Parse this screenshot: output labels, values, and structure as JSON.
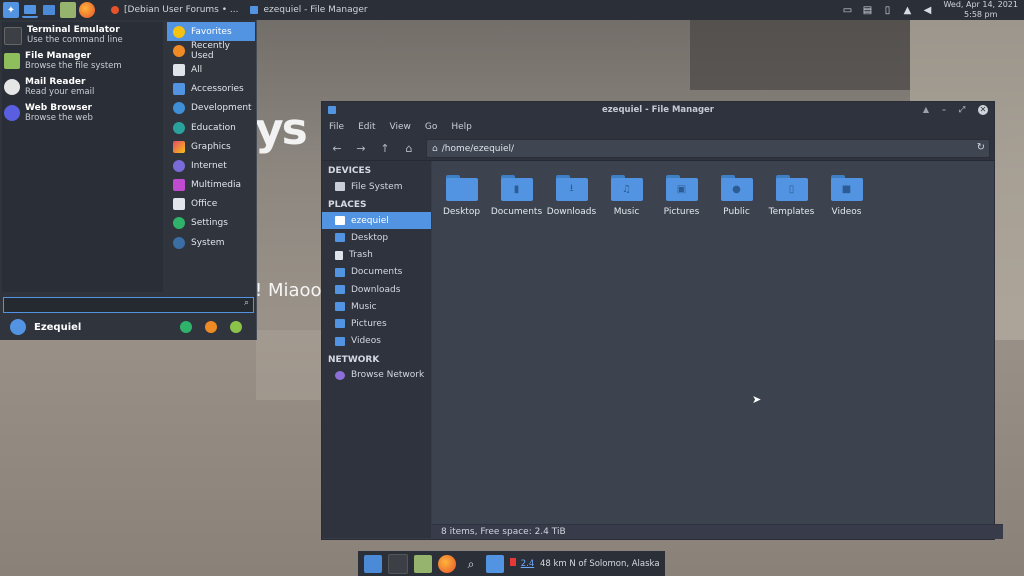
{
  "top_panel": {
    "tasks": [
      {
        "label": "[Debian User Forums • ..."
      },
      {
        "label": "ezequiel - File Manager"
      }
    ],
    "clock": {
      "date": "Wed, Apr 14, 2021",
      "time": "5:58 pm"
    }
  },
  "desktop": {
    "text_large": "ys",
    "text_small": "! Miaoo"
  },
  "whisker_menu": {
    "favorites": [
      {
        "title": "Terminal Emulator",
        "subtitle": "Use the command line",
        "icon": "terminal-icon",
        "color": "#3c3f45"
      },
      {
        "title": "File Manager",
        "subtitle": "Browse the file system",
        "icon": "file-manager-icon",
        "color": "#8fbf5c"
      },
      {
        "title": "Mail Reader",
        "subtitle": "Read your email",
        "icon": "mail-icon",
        "color": "#e6e6e6"
      },
      {
        "title": "Web Browser",
        "subtitle": "Browse the web",
        "icon": "browser-icon",
        "color": "#5a5ee0"
      }
    ],
    "categories": [
      {
        "label": "Favorites",
        "color": "#f5c211",
        "active": true
      },
      {
        "label": "Recently Used",
        "color": "#f08a24"
      },
      {
        "label": "All",
        "color": "#dfe3ea"
      },
      {
        "label": "Accessories",
        "color": "#5294e2"
      },
      {
        "label": "Development",
        "color": "#3f8fd8"
      },
      {
        "label": "Education",
        "color": "#2aa19c"
      },
      {
        "label": "Graphics",
        "color": "#e54a6a"
      },
      {
        "label": "Internet",
        "color": "#7a6cd8"
      },
      {
        "label": "Multimedia",
        "color": "#c04bd0"
      },
      {
        "label": "Office",
        "color": "#e2e6ec"
      },
      {
        "label": "Settings",
        "color": "#2fb36b"
      },
      {
        "label": "System",
        "color": "#3a6ea5"
      }
    ],
    "search_value": "",
    "user_name": "Ezequiel"
  },
  "file_manager": {
    "title": "ezequiel - File Manager",
    "menu": [
      "File",
      "Edit",
      "View",
      "Go",
      "Help"
    ],
    "path": "/home/ezequiel/",
    "sidebar": {
      "devices_header": "DEVICES",
      "devices": [
        {
          "label": "File System",
          "icon": "drive-icon"
        }
      ],
      "places_header": "PLACES",
      "places": [
        {
          "label": "ezequiel",
          "icon": "home-icon",
          "active": true
        },
        {
          "label": "Desktop",
          "icon": "desktop-icon"
        },
        {
          "label": "Trash",
          "icon": "trash-icon"
        },
        {
          "label": "Documents",
          "icon": "folder-icon"
        },
        {
          "label": "Downloads",
          "icon": "folder-icon"
        },
        {
          "label": "Music",
          "icon": "folder-icon"
        },
        {
          "label": "Pictures",
          "icon": "folder-icon"
        },
        {
          "label": "Videos",
          "icon": "folder-icon"
        }
      ],
      "network_header": "NETWORK",
      "network": [
        {
          "label": "Browse Network",
          "icon": "network-icon"
        }
      ]
    },
    "items": [
      {
        "label": "Desktop",
        "glyph": ""
      },
      {
        "label": "Documents",
        "glyph": "▮"
      },
      {
        "label": "Downloads",
        "glyph": "⭳"
      },
      {
        "label": "Music",
        "glyph": "♫"
      },
      {
        "label": "Pictures",
        "glyph": "▣"
      },
      {
        "label": "Public",
        "glyph": "●"
      },
      {
        "label": "Templates",
        "glyph": "▯"
      },
      {
        "label": "Videos",
        "glyph": "■"
      }
    ],
    "status": "8 items, Free space: 2.4 TiB"
  },
  "dock": {
    "weather_temp": "2.4",
    "weather_text": "48 km N of Solomon, Alaska"
  },
  "colors": {
    "accent": "#5294e2",
    "panel": "#2b2f37",
    "window_bg": "#383c4a"
  }
}
